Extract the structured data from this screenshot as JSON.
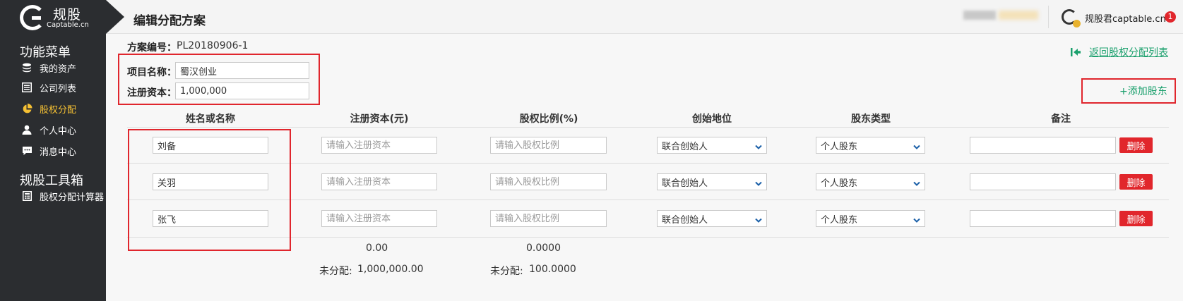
{
  "header": {
    "logo_cn": "规股",
    "logo_en": "Captable.cn",
    "page_title": "编辑分配方案",
    "user_name": "规股君captable.cn",
    "notification_count": "1"
  },
  "sidebar": {
    "menu_title": "功能菜单",
    "items": [
      {
        "label": "我的资产",
        "icon": "database-icon"
      },
      {
        "label": "公司列表",
        "icon": "list-icon"
      },
      {
        "label": "股权分配",
        "icon": "pie-chart-icon"
      },
      {
        "label": "个人中心",
        "icon": "user-icon"
      },
      {
        "label": "消息中心",
        "icon": "message-icon"
      }
    ],
    "toolbox_title": "规股工具箱",
    "tools": [
      {
        "label": "股权分配计算器",
        "icon": "calculator-icon"
      }
    ]
  },
  "plan": {
    "number_label": "方案编号：",
    "number_value": "PL20180906-1",
    "project_label": "项目名称：",
    "project_value": "蜀汉创业",
    "capital_label": "注册资本：",
    "capital_value": "1,000,000"
  },
  "actions": {
    "back_label": "返回股权分配列表",
    "add_label": "+添加股东"
  },
  "table": {
    "headers": [
      "姓名或名称",
      "注册资本(元)",
      "股权比例(%)",
      "创始地位",
      "股东类型",
      "备注"
    ],
    "capital_placeholder": "请输入注册资本",
    "ratio_placeholder": "请输入股权比例",
    "delete_label": "删除",
    "rows": [
      {
        "name": "刘备",
        "capital": "",
        "ratio": "",
        "role": "联合创始人",
        "type": "个人股东",
        "note": ""
      },
      {
        "name": "关羽",
        "capital": "",
        "ratio": "",
        "role": "联合创始人",
        "type": "个人股东",
        "note": ""
      },
      {
        "name": "张飞",
        "capital": "",
        "ratio": "",
        "role": "联合创始人",
        "type": "个人股东",
        "note": ""
      }
    ]
  },
  "totals": {
    "capital_sum": "0.00",
    "ratio_sum": "0.0000",
    "unallocated_label": "未分配:",
    "capital_unallocated": "1,000,000.00",
    "ratio_unallocated": "100.0000"
  },
  "colors": {
    "sidebar_bg": "#2b2d30",
    "accent_green": "#1ba06d",
    "active_yellow": "#f5c033",
    "danger_red": "#e1262c"
  }
}
